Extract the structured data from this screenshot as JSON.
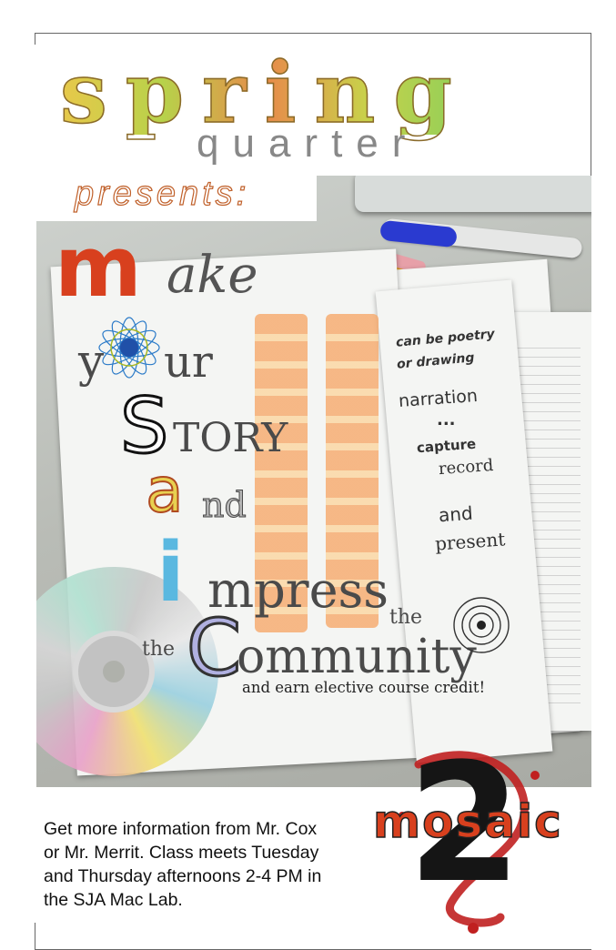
{
  "header": {
    "title": "spring",
    "subtitle": "quarter",
    "presents": "presents:"
  },
  "headline": {
    "make_initial": "m",
    "make_rest": "ake",
    "your_y": "y",
    "your_rest": "ur",
    "story_initial": "S",
    "story_rest": "TORY",
    "and_initial": "a",
    "and_rest": "nd",
    "impress_initial": "i",
    "impress_rest": "mpress",
    "the_left": "the",
    "community_initial": "C",
    "community_rest": "ommunity",
    "the_right": "the",
    "credit": "and earn elective course credit!"
  },
  "paper_notes": {
    "line1": "can be poetry",
    "line2": "or drawing",
    "narration": "narration",
    "ellipsis": "...",
    "capture": "capture",
    "record": "record",
    "and": "and",
    "present": "present"
  },
  "info": {
    "line1": "Get more information from Mr. Cox",
    "line2": "or Mr. Merrit. Class meets Tuesday",
    "line3": "and Thursday afternoons 2-4 PM in",
    "line4": "the SJA Mac Lab."
  },
  "logo": {
    "numeral": "2",
    "word": "mosaic"
  },
  "colors": {
    "accent_red": "#d8401e",
    "ink_gray": "#4a4a4a",
    "flower_blue": "#2060c0"
  }
}
